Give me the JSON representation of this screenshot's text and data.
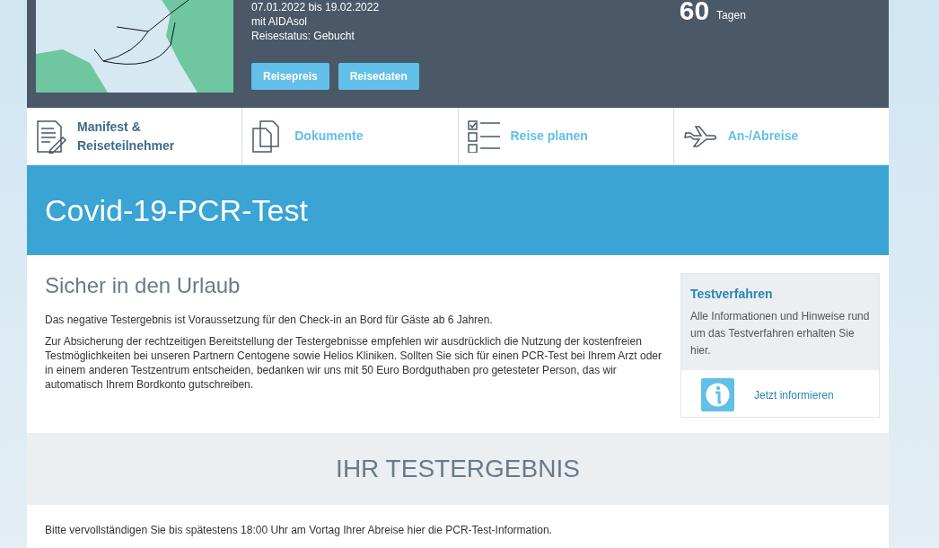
{
  "trip": {
    "dates": "07.01.2022 bis 19.02.2022",
    "ship": "mit AIDAsol",
    "status": "Reisestatus: Gebucht",
    "buttons": [
      "Reisepreis",
      "Reisedaten"
    ],
    "countdown": "60",
    "countdown_unit": "Tagen"
  },
  "tabs": [
    {
      "label": "Manifest & Reiseteilnehmer",
      "kind": "manifest",
      "selected": true
    },
    {
      "label": "Dokumente",
      "kind": "documents",
      "selected": false
    },
    {
      "label": "Reise planen",
      "kind": "checklist",
      "selected": false
    },
    {
      "label": "An-/Abreise",
      "kind": "plane",
      "selected": false
    }
  ],
  "banner_title": "Covid-19-PCR-Test",
  "section": {
    "heading": "Sicher in den Urlaub",
    "paragraphs": [
      "Das negative Testergebnis ist Voraussetzung für den Check-in an Bord für Gäste ab 6 Jahren.",
      "Zur Absicherung der rechtzeitigen Bereitstellung der Testergebnisse empfehlen wir ausdrücklich die Nutzung der kostenfreien Testmöglichkeiten bei unseren Partnern Centogene sowie Helios Kliniken. Sollten Sie sich für einen PCR-Test bei Ihrem Arzt oder in einem anderen Testzentrum entscheiden, bedanken wir uns mit 50 Euro Bordguthaben pro getesteter Person, das wir automatisch Ihrem Bordkonto gutschreiben."
    ]
  },
  "info_box": {
    "title": "Testverfahren",
    "text": "Alle Informationen und Hinweise rund um das Testverfahren erhalten Sie hier.",
    "link": "Jetzt informieren"
  },
  "result": {
    "heading": "IHR TESTERGEBNIS",
    "text": "Bitte vervollständigen Sie bis spätestens 18:00 Uhr am Vortag Ihrer Abreise hier die PCR-Test-Information."
  }
}
